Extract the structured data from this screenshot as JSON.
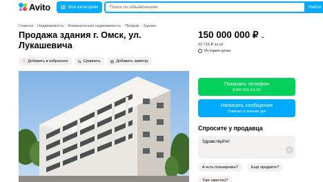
{
  "header": {
    "logo_text": "Avito",
    "categories_label": "Все категории",
    "search_placeholder": "Поиск по объявлениям",
    "find_label": "Найти"
  },
  "breadcrumb": [
    "Главная",
    "Недвижимость",
    "Коммерческая недвижимость",
    "Продам",
    "Здание"
  ],
  "listing": {
    "title": "Продажа здания г. Омск, ул. Лукашевича",
    "price": "150 000 000 ₽",
    "price_per_m2": "32 715 ₽ за м²",
    "price_history": "История цены"
  },
  "actions": {
    "favorite": "Добавить в избранное",
    "compare": "Сравнить",
    "note": "Добавить заметку"
  },
  "contact": {
    "phone_label": "Показать телефон",
    "phone_masked": "8 992 XXX-XX-XX",
    "message_label": "Написать сообщение",
    "message_sub": "Отвечает в течение дня"
  },
  "ask": {
    "title": "Спросите у продавца",
    "message": "Здравствуйте!",
    "chips": [
      "А есть планировка?",
      "Ещё продаёте?",
      "Торг уместен?"
    ]
  },
  "icons": {
    "menu": "menu-icon",
    "heart": "heart-icon",
    "compare": "compare-icon",
    "note": "note-icon",
    "clock": "clock-icon",
    "send": "send-icon",
    "chevron": "chevron-down-icon"
  },
  "colors": {
    "accent": "#00aaff",
    "phone_button": "#02d15c",
    "chip_bg": "#f2f1f0"
  }
}
